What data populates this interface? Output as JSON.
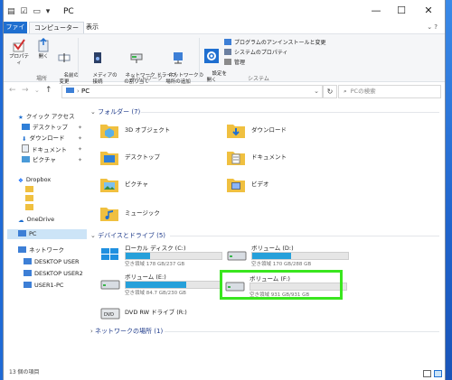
{
  "window": {
    "title": "PC",
    "controls": {
      "minimize": "—",
      "maximize": "☐",
      "close": "✕"
    }
  },
  "ribbon_tabs": {
    "file": "ファイル",
    "computer": "コンピューター",
    "view": "表示"
  },
  "ribbon": {
    "groups": {
      "location": "場所",
      "network": "ネットワーク",
      "system": "システム"
    },
    "buttons": {
      "properties": "プロパティ",
      "open": "開く",
      "rename": "名前の\n変更",
      "media": "メディアの\n接続",
      "map_drive": "ネットワーク ドライブ\nの割り当て",
      "add_location": "ネットワークの\n場所の追加",
      "settings": "設定を\n開く"
    },
    "small_items": {
      "uninstall": "プログラムのアンインストールと変更",
      "sys_props": "システムのプロパティ",
      "manage": "管理"
    }
  },
  "address": {
    "path": "PC",
    "search_placeholder": "PCの検索"
  },
  "navigation": {
    "quick_access": "クイック アクセス",
    "desktop": "デスクトップ",
    "downloads": "ダウンロード",
    "documents": "ドキュメント",
    "pictures": "ピクチャ",
    "dropbox": "Dropbox",
    "onedrive": "OneDrive",
    "pc": "PC",
    "network": "ネットワーク",
    "net_items": [
      "DESKTOP USER",
      "DESKTOP USER2",
      "USER1-PC"
    ]
  },
  "content": {
    "folders_header": "フォルダー (7)",
    "folders": [
      "3D オブジェクト",
      "ダウンロード",
      "デスクトップ",
      "ドキュメント",
      "ピクチャ",
      "ビデオ",
      "ミュージック"
    ],
    "devices_header": "デバイスとドライブ (5)",
    "drives": [
      {
        "name": "ローカル ディスク (C:)",
        "space": "空き領域 178 GB/237 GB",
        "used_fraction": 0.25
      },
      {
        "name": "ボリューム (D:)",
        "space": "空き領域 170 GB/288 GB",
        "used_fraction": 0.41
      },
      {
        "name": "ボリューム (E:)",
        "space": "空き領域 84.7 GB/230 GB",
        "used_fraction": 0.63
      },
      {
        "name": "ボリューム (F:)",
        "space": "空き領域 931 GB/931 GB",
        "used_fraction": 0.0
      },
      {
        "name": "DVD RW ドライブ (R:)",
        "space": "",
        "used_fraction": null
      }
    ],
    "network_header": "ネットワークの場所 (1)"
  },
  "status": {
    "count": "13 個の項目"
  },
  "colors": {
    "accent": "#1f6fd0",
    "bar_fill": "#26a0da",
    "highlight": "#39e61e",
    "folder": "#f0c040"
  }
}
